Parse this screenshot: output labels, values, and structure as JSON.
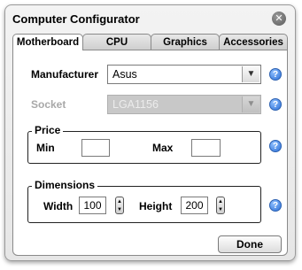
{
  "window": {
    "title": "Computer Configurator",
    "close_glyph": "✕"
  },
  "tabs": [
    {
      "label": "Motherboard",
      "active": true
    },
    {
      "label": "CPU",
      "active": false
    },
    {
      "label": "Graphics",
      "active": false
    },
    {
      "label": "Accessories",
      "active": false
    }
  ],
  "motherboard": {
    "manufacturer": {
      "label": "Manufacturer",
      "value": "Asus",
      "enabled": true
    },
    "socket": {
      "label": "Socket",
      "value": "LGA1156",
      "enabled": false
    },
    "price": {
      "legend": "Price",
      "min_label": "Min",
      "min_value": "",
      "max_label": "Max",
      "max_value": ""
    },
    "dimensions": {
      "legend": "Dimensions",
      "width_label": "Width",
      "width_value": "100",
      "height_label": "Height",
      "height_value": "200"
    }
  },
  "help_glyph": "?",
  "done_label": "Done",
  "icons": {
    "close": "close-icon",
    "help": "help-icon",
    "dropdown": "chevron-down-icon",
    "stepper": "stepper-arrows-icon"
  },
  "colors": {
    "help_blue": "#2c6fd6",
    "disabled_field": "#c8c8c8"
  }
}
